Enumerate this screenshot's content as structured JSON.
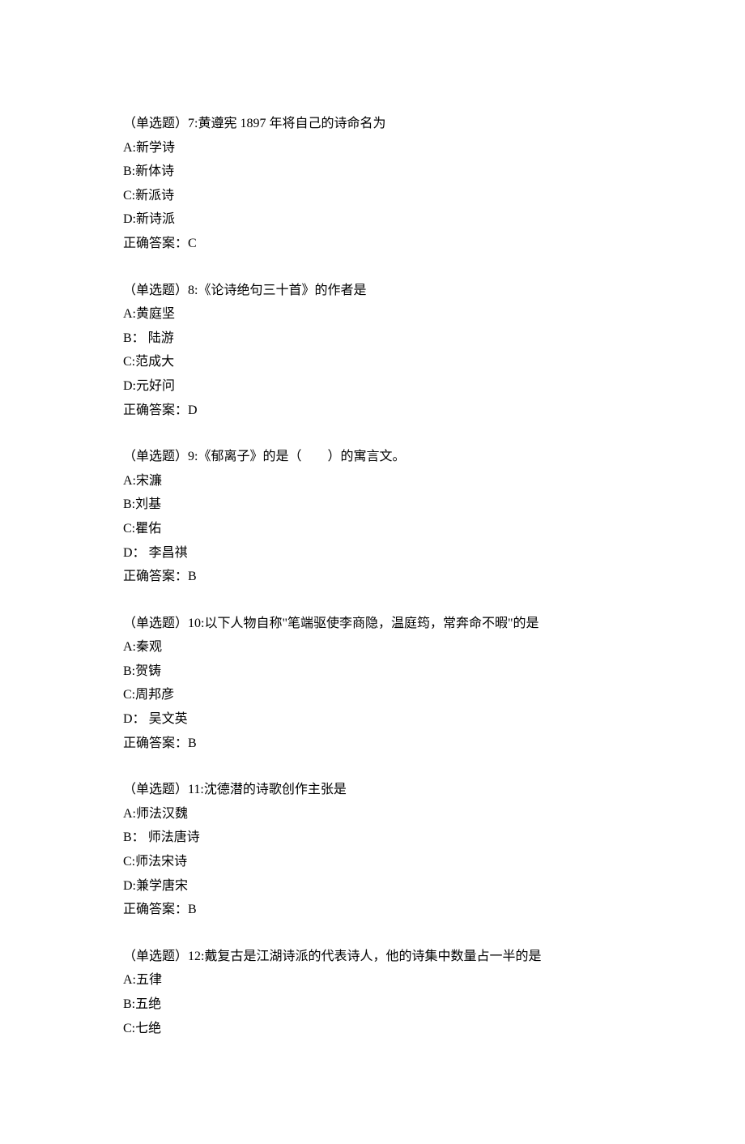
{
  "questions": [
    {
      "prefix": "（单选题）7:",
      "text": "黄遵宪 1897 年将自己的诗命名为",
      "options": [
        {
          "label": "A:",
          "text": "新学诗"
        },
        {
          "label": "B:",
          "text": "新体诗"
        },
        {
          "label": "C:",
          "text": "新派诗"
        },
        {
          "label": "D:",
          "text": "新诗派"
        }
      ],
      "answer_label": "正确答案：",
      "answer": "C"
    },
    {
      "prefix": "（单选题）8:",
      "text": "《论诗绝句三十首》的作者是",
      "options": [
        {
          "label": "A:",
          "text": "黄庭坚"
        },
        {
          "label": "B：",
          "text": " 陆游"
        },
        {
          "label": "C:",
          "text": "范成大"
        },
        {
          "label": "D:",
          "text": "元好问"
        }
      ],
      "answer_label": "正确答案：",
      "answer": "D"
    },
    {
      "prefix": "（单选题）9:",
      "text": "《郁离子》的是（　　）的寓言文。",
      "options": [
        {
          "label": "A:",
          "text": "宋濂"
        },
        {
          "label": "B:",
          "text": "刘基"
        },
        {
          "label": "C:",
          "text": "瞿佑"
        },
        {
          "label": "D：",
          "text": " 李昌祺"
        }
      ],
      "answer_label": "正确答案：",
      "answer": "B"
    },
    {
      "prefix": "（单选题）10:",
      "text": "以下人物自称\"笔端驱使李商隐，温庭筠，常奔命不暇\"的是",
      "options": [
        {
          "label": "A:",
          "text": "秦观"
        },
        {
          "label": "B:",
          "text": "贺铸"
        },
        {
          "label": "C:",
          "text": "周邦彦"
        },
        {
          "label": "D：",
          "text": " 吴文英"
        }
      ],
      "answer_label": "正确答案：",
      "answer": "B"
    },
    {
      "prefix": "（单选题）11:",
      "text": "沈德潜的诗歌创作主张是",
      "options": [
        {
          "label": "A:",
          "text": "师法汉魏"
        },
        {
          "label": "B：",
          "text": " 师法唐诗"
        },
        {
          "label": "C:",
          "text": "师法宋诗"
        },
        {
          "label": "D:",
          "text": "兼学唐宋"
        }
      ],
      "answer_label": "正确答案：",
      "answer": "B"
    },
    {
      "prefix": "（单选题）12:",
      "text": "戴复古是江湖诗派的代表诗人，他的诗集中数量占一半的是",
      "options": [
        {
          "label": "A:",
          "text": "五律"
        },
        {
          "label": "B:",
          "text": "五绝"
        },
        {
          "label": "C:",
          "text": "七绝"
        }
      ],
      "answer_label": "",
      "answer": ""
    }
  ]
}
